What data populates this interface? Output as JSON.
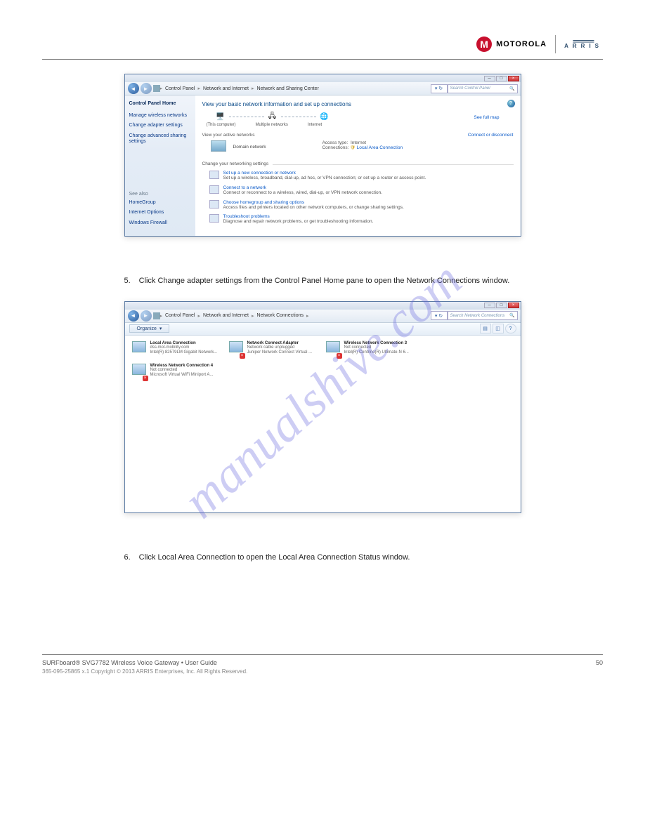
{
  "logos": {
    "motorola": "MOTOROLA",
    "arris": "ARRIS"
  },
  "watermark": "manualshive.com",
  "window1": {
    "titlebar": {
      "min": "─",
      "max": "□",
      "close": "×"
    },
    "breadcrumb": [
      "Control Panel",
      "Network and Internet",
      "Network and Sharing Center"
    ],
    "search_placeholder": "Search Control Panel",
    "left": {
      "home": "Control Panel Home",
      "links": [
        "Manage wireless networks",
        "Change adapter settings",
        "Change advanced sharing settings"
      ],
      "see_also_h": "See also",
      "see_also": [
        "HomeGroup",
        "Internet Options",
        "Windows Firewall"
      ]
    },
    "content": {
      "heading": "View your basic network information and set up connections",
      "see_full_map": "See full map",
      "map_labels": [
        "(This computer)",
        "Multiple networks",
        "Internet"
      ],
      "active_h": "View your active networks",
      "connect_link": "Connect or disconnect",
      "domain_label": "Domain network",
      "access_type_l": "Access type:",
      "access_type_v": "Internet",
      "connections_l": "Connections:",
      "connections_v": "Local Area Connection",
      "change_h": "Change your networking settings",
      "opts": [
        {
          "title": "Set up a new connection or network",
          "desc": "Set up a wireless, broadband, dial-up, ad hoc, or VPN connection; or set up a router or access point."
        },
        {
          "title": "Connect to a network",
          "desc": "Connect or reconnect to a wireless, wired, dial-up, or VPN network connection."
        },
        {
          "title": "Choose homegroup and sharing options",
          "desc": "Access files and printers located on other network computers, or change sharing settings."
        },
        {
          "title": "Troubleshoot problems",
          "desc": "Diagnose and repair network problems, or get troubleshooting information."
        }
      ]
    }
  },
  "instr1": {
    "num": "5.",
    "text": "Click Change adapter settings from the Control Panel Home pane to open the Network Connections window."
  },
  "window2": {
    "breadcrumb": [
      "Control Panel",
      "Network and Internet",
      "Network Connections"
    ],
    "search_placeholder": "Search Network Connections",
    "organize": "Organize",
    "items": [
      {
        "name": "Local Area Connection",
        "status": "dss.mot-mobility.com",
        "dev": "Intel(R) 82579LM Gigabit Network...",
        "x": false
      },
      {
        "name": "Network Connect Adapter",
        "status": "Network cable unplugged",
        "dev": "Juniper Network Connect Virtual ...",
        "x": true
      },
      {
        "name": "Wireless Network Connection 3",
        "status": "Not connected",
        "dev": "Intel(R) Centrino(R) Ultimate-N 6...",
        "x": true
      },
      {
        "name": "Wireless Network Connection 4",
        "status": "Not connected",
        "dev": "Microsoft Virtual WiFi Miniport A...",
        "x": true
      }
    ]
  },
  "instr2": {
    "num": "6.",
    "text": "Click Local Area Connection to open the Local Area Connection Status window."
  },
  "footer": {
    "left": "SURFboard® SVG7782 Wireless Voice Gateway • User Guide",
    "right": "50",
    "copyright": "365-095-25865 x.1 Copyright © 2013 ARRIS Enterprises, Inc. All Rights Reserved."
  }
}
